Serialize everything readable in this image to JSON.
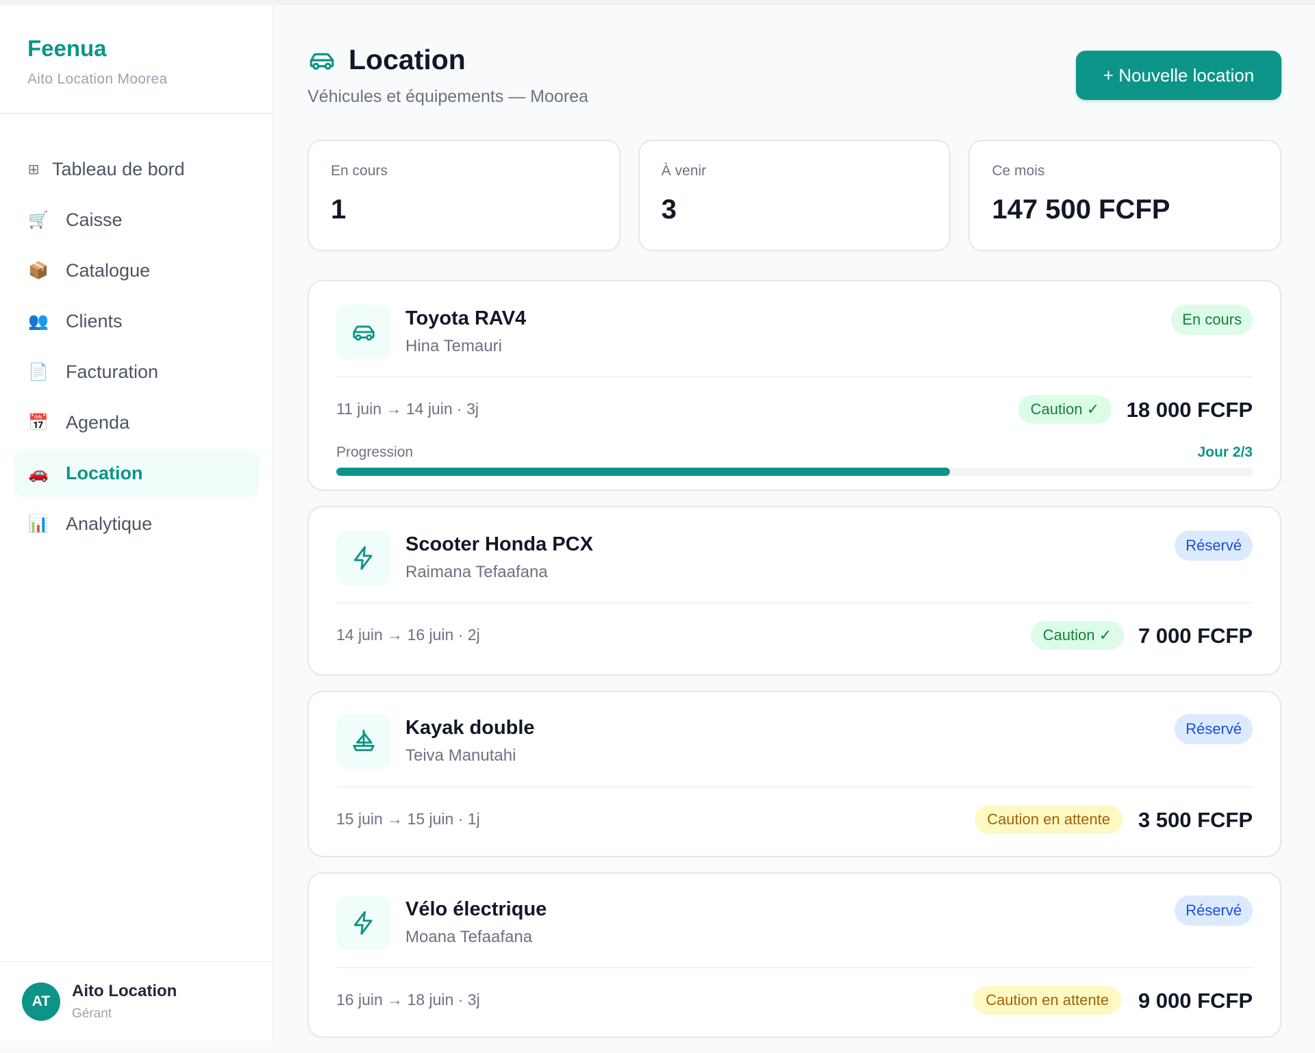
{
  "brand": {
    "name": "Feenua",
    "subtitle": "Aito Location Moorea"
  },
  "sidebar": {
    "items": [
      {
        "label": "Tableau de bord",
        "icon": "grid-icon",
        "glyph": "⊞",
        "active": false
      },
      {
        "label": "Caisse",
        "icon": "cart-icon",
        "glyph": "🛒",
        "active": false
      },
      {
        "label": "Catalogue",
        "icon": "package-icon",
        "glyph": "📦",
        "active": false
      },
      {
        "label": "Clients",
        "icon": "users-icon",
        "glyph": "👥",
        "active": false
      },
      {
        "label": "Facturation",
        "icon": "document-icon",
        "glyph": "📄",
        "active": false
      },
      {
        "label": "Agenda",
        "icon": "calendar-icon",
        "glyph": "📅",
        "active": false
      },
      {
        "label": "Location",
        "icon": "car-icon",
        "glyph": "🚗",
        "active": true
      },
      {
        "label": "Analytique",
        "icon": "bar-chart-icon",
        "glyph": "📊",
        "active": false
      }
    ]
  },
  "user": {
    "initials": "AT",
    "name": "Aito Location",
    "role": "Gérant"
  },
  "header": {
    "title": "Location",
    "subtitle": "Véhicules et équipements — Moorea",
    "new_button": "+ Nouvelle location"
  },
  "stats": [
    {
      "label": "En cours",
      "value": "1"
    },
    {
      "label": "À venir",
      "value": "3"
    },
    {
      "label": "Ce mois",
      "value": "147 500 FCFP"
    }
  ],
  "rentals": [
    {
      "title": "Toyota RAV4",
      "client": "Hina Temauri",
      "icon": "car-icon",
      "status": "En cours",
      "status_color": "green",
      "dates": "11 juin → 14 juin · 3j",
      "caution": "Caution ✓",
      "caution_state": "ok",
      "price": "18 000 FCFP",
      "progress": {
        "label": "Progression",
        "day": "Jour 2/3",
        "fraction": 0.67
      }
    },
    {
      "title": "Scooter Honda PCX",
      "client": "Raimana Tefaafana",
      "icon": "lightning-icon",
      "status": "Réservé",
      "status_color": "blue",
      "dates": "14 juin → 16 juin · 2j",
      "caution": "Caution ✓",
      "caution_state": "ok",
      "price": "7 000 FCFP"
    },
    {
      "title": "Kayak double",
      "client": "Teiva Manutahi",
      "icon": "sailboat-icon",
      "status": "Réservé",
      "status_color": "blue",
      "dates": "15 juin → 15 juin · 1j",
      "caution": "Caution en attente",
      "caution_state": "wait",
      "price": "3 500 FCFP"
    },
    {
      "title": "Vélo électrique",
      "client": "Moana Tefaafana",
      "icon": "lightning-icon",
      "status": "Réservé",
      "status_color": "blue",
      "dates": "16 juin → 18 juin · 3j",
      "caution": "Caution en attente",
      "caution_state": "wait",
      "price": "9 000 FCFP"
    }
  ]
}
